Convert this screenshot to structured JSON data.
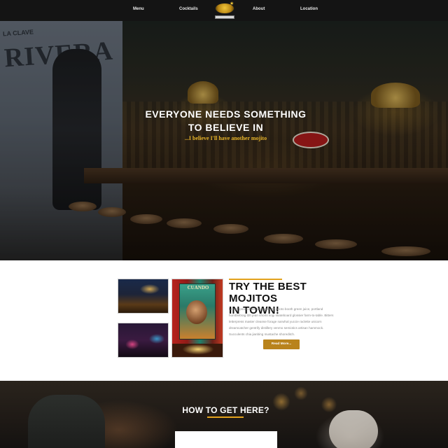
{
  "nav": {
    "items": [
      {
        "label": "Menu"
      },
      {
        "label": "Cocktails"
      },
      {
        "label": "About"
      },
      {
        "label": "Location"
      }
    ],
    "logo_icon": "cocktail-bar-logo"
  },
  "hero": {
    "title_line1": "EVERYONE NEEDS SOMETHING",
    "title_line2": "TO BELIEVE IN",
    "subtitle": "...I believe I'll have another mojito",
    "mural_text": "RIVERA",
    "mural_sub": "LA CLAVE"
  },
  "mojito": {
    "title_line1": "TRY THE BEST MOJITOS",
    "title_line2": "IN TOWN!",
    "body": "Lorem ipsum dolor amet unicorn photo booth green juice, portland humblebrag tbh jean shorts kogi skateboard glossier farm-to-table. Bitters letterpress master cleanse forage narwhal yuccie raclette unicorn dreamcatcher gentrify distillery venmo semiotics artisan hammock. Succulents chia jianbing mustache shoreditch.",
    "button_label": "Read More...",
    "poster_text": "CUANDO"
  },
  "gethere": {
    "title": "HOW TO GET HERE?"
  },
  "colors": {
    "accent": "#e2a21c",
    "button": "#b9831c",
    "nav_bg": "#141414",
    "hero_subtitle": "#e7b42a"
  }
}
